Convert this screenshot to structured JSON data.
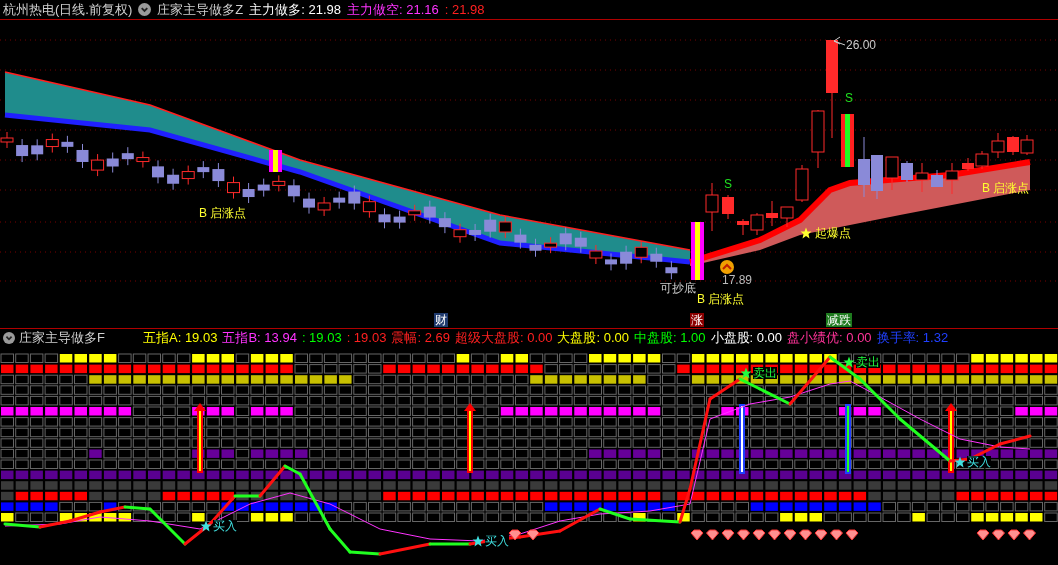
{
  "header": {
    "symbol": "杭州热电(日线.前复权)",
    "indicator": "庄家主导做多Z",
    "readings": [
      {
        "text": "主力做多: 21.98",
        "color": "#ffffff"
      },
      {
        "text": "主力做空: 21.16",
        "color": "#ff33ff"
      },
      {
        "text": ": 21.98",
        "color": "#ff2020"
      }
    ]
  },
  "main_chart": {
    "price_high": "26.00",
    "price_low": "17.89",
    "signals": [
      {
        "kind": "sell",
        "text": "S"
      },
      {
        "kind": "sell",
        "text": "S"
      },
      {
        "kind": "start",
        "text": "B 启涨点"
      },
      {
        "kind": "start",
        "text": "B 启涨点"
      },
      {
        "kind": "start",
        "text": "B 启涨点"
      },
      {
        "kind": "burst",
        "text": "起爆点"
      },
      {
        "kind": "bottom",
        "text": "可抄底"
      }
    ],
    "markers": [
      {
        "text": "财",
        "color": "#1f3a6e"
      },
      {
        "text": "涨",
        "color": "#8b0000"
      },
      {
        "text": "减跌",
        "color": "#1e7a1e"
      }
    ]
  },
  "sub_panel": {
    "indicator": "庄家主导做多F",
    "readings": [
      {
        "text": "五指A: 19.03",
        "color": "#ffff00"
      },
      {
        "text": "五指B: 13.94",
        "color": "#ff33ff"
      },
      {
        "text": ": 19.03",
        "color": "#00ff00"
      },
      {
        "text": ": 19.03",
        "color": "#ff2020"
      },
      {
        "text": "震幅: 2.69",
        "color": "#ff2020"
      },
      {
        "text": "超级大盘股: 0.00",
        "color": "#ff2020"
      },
      {
        "text": "大盘股: 0.00",
        "color": "#ffff00"
      },
      {
        "text": "中盘股: 1.00",
        "color": "#00ff00"
      },
      {
        "text": "小盘股: 0.00",
        "color": "#ffffff"
      },
      {
        "text": "盘小绩优: 0.00",
        "color": "#ff3399"
      },
      {
        "text": "换手率: 1.32",
        "color": "#2040ff"
      }
    ],
    "signals": [
      {
        "kind": "buy",
        "text": "买入"
      },
      {
        "kind": "buy",
        "text": "买入"
      },
      {
        "kind": "buy",
        "text": "买入"
      },
      {
        "kind": "sell",
        "text": "卖出"
      },
      {
        "kind": "sell",
        "text": "卖出"
      }
    ]
  }
}
